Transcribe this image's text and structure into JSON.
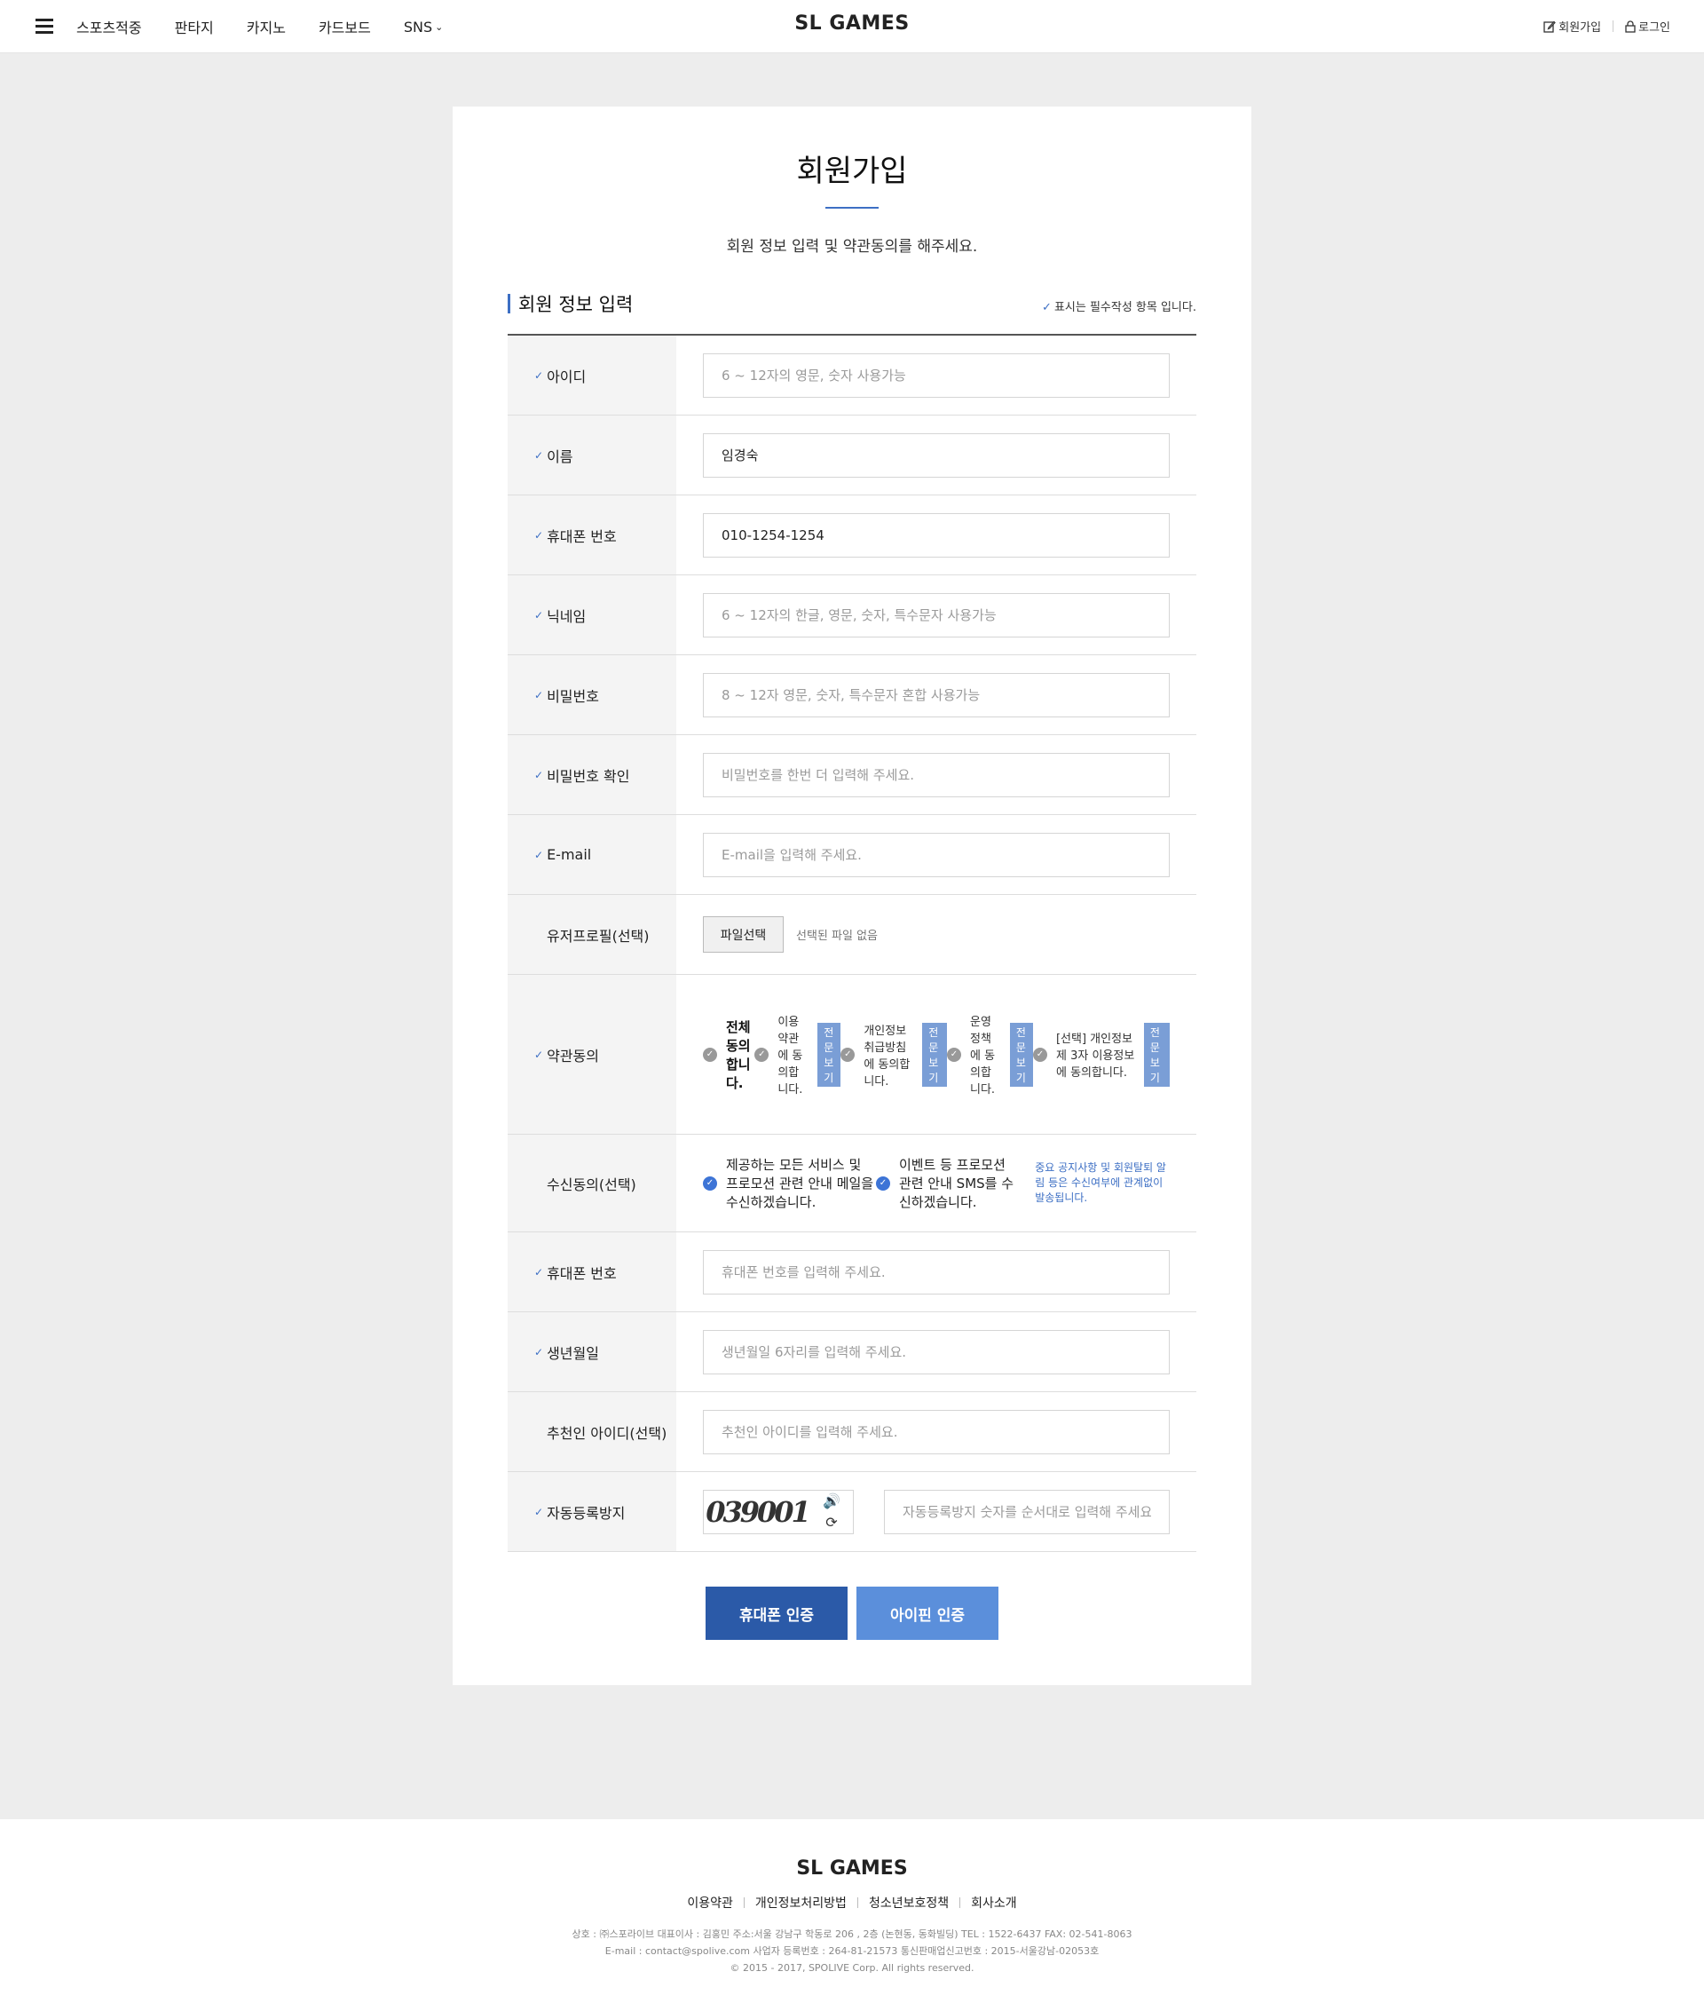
{
  "header": {
    "nav": [
      "스포츠적중",
      "판타지",
      "카지노",
      "카드보드",
      "SNS"
    ],
    "logo": "SL GAMES",
    "signup": "회원가입",
    "login": "로그인"
  },
  "page": {
    "title": "회원가입",
    "subtitle": "회원 정보 입력 및 약관동의를 해주세요.",
    "section_title": "회원 정보 입력",
    "required_note": "표시는 필수작성 항목 입니다."
  },
  "form": {
    "id": {
      "label": "아이디",
      "value": "",
      "placeholder": "6 ~ 12자의 영문, 숫자 사용가능"
    },
    "name": {
      "label": "이름",
      "value": "임경숙",
      "placeholder": ""
    },
    "phone": {
      "label": "휴대폰 번호",
      "value": "010-1254-1254",
      "placeholder": ""
    },
    "nickname": {
      "label": "닉네임",
      "value": "",
      "placeholder": "6 ~ 12자의 한글, 영문, 숫자, 특수문자 사용가능"
    },
    "password": {
      "label": "비밀번호",
      "value": "",
      "placeholder": "8 ~ 12자 영문, 숫자, 특수문자 혼합 사용가능"
    },
    "password_confirm": {
      "label": "비밀번호 확인",
      "value": "",
      "placeholder": "비밀번호를 한번 더 입력해 주세요."
    },
    "email": {
      "label": "E-mail",
      "value": "",
      "placeholder": "E-mail을 입력해 주세요."
    },
    "profile": {
      "label": "유저프로필(선택)",
      "button": "파일선택",
      "status": "선택된 파일 없음"
    },
    "terms": {
      "label": "약관동의",
      "all": "전체 동의합니다.",
      "view": "전문보기",
      "items": [
        "이용약관에 동의합니다.",
        "개인정보 취급방침에 동의합니다.",
        "운영정책에 동의합니다.",
        "[선택] 개인정보 제 3자 이용정보에 동의합니다."
      ]
    },
    "receive": {
      "label": "수신동의(선택)",
      "email": "제공하는 모든 서비스 및 프로모션 관련 안내 메일을 수신하겠습니다.",
      "sms": "이벤트 등 프로모션 관련 안내 SMS를 수신하겠습니다.",
      "note": "중요 공지사항 및 회원탈퇴 알림 등은 수신여부에 관계없이 발송됩니다."
    },
    "phone2": {
      "label": "휴대폰 번호",
      "value": "",
      "placeholder": "휴대폰 번호를 입력해 주세요."
    },
    "birth": {
      "label": "생년월일",
      "value": "",
      "placeholder": "생년월일 6자리를 입력해 주세요."
    },
    "referrer": {
      "label": "추천인 아이디(선택)",
      "value": "",
      "placeholder": "추천인 아이디를 입력해 주세요."
    },
    "captcha": {
      "label": "자동등록방지",
      "code": "039001",
      "placeholder": "자동등록방지 숫자를 순서대로 입력해 주세요."
    }
  },
  "buttons": {
    "phone_auth": "휴대폰 인증",
    "ipin_auth": "아이핀 인증"
  },
  "footer": {
    "logo": "SL GAMES",
    "links": [
      "이용약관",
      "개인정보처리방법",
      "청소년보호정책",
      "회사소개"
    ],
    "info": [
      "상호 : ㈜스포라이브 대표이사 : 김홍민  주소:서울 강남구 학동로 206 , 2층 (논현동, 동화빌딩)  TEL : 1522-6437 FAX: 02-541-8063",
      "E-mail : contact@spolive.com 사업자 등록번호 : 264-81-21573 통신판매업신고번호 : 2015-서울강남-02053호",
      "© 2015 - 2017, SPOLIVE Corp. All rights reserved."
    ]
  },
  "colors": {
    "accent": "#3d6fc4",
    "button_dark": "#2b5aa8",
    "button_light": "#5b8fdb",
    "background": "#ededed"
  }
}
